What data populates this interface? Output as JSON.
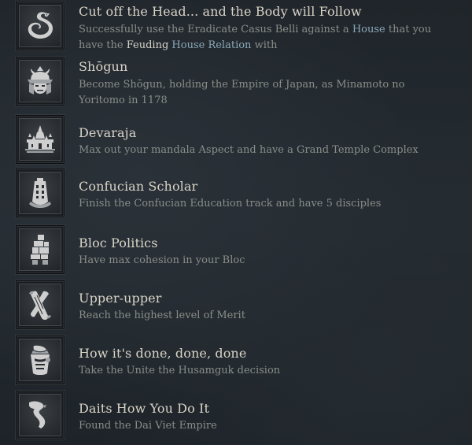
{
  "achievements": [
    {
      "title": "Cut off the Head... and the Body will Follow",
      "description": {
        "part1": "Successfully use the Eradicate Casus Belli against a ",
        "link1": "House",
        "part2": " that you have the ",
        "bold1": "Feuding",
        "part3": " ",
        "link2": "House Relation",
        "part4": " with"
      },
      "icon": "serpent-icon"
    },
    {
      "title": "Shōgun",
      "description": "Become Shōgun, holding the Empire of Japan, as Minamoto no Yoritomo in 1178",
      "icon": "samurai-helmet-icon"
    },
    {
      "title": "Devaraja",
      "description": "Max out your mandala Aspect and have a Grand Temple Complex",
      "icon": "temple-icon"
    },
    {
      "title": "Confucian Scholar",
      "description": "Finish the Confucian Education track and have 5 disciples",
      "icon": "bell-icon"
    },
    {
      "title": "Bloc Politics",
      "description": "Have max cohesion in your Bloc",
      "icon": "stacked-blocks-icon"
    },
    {
      "title": "Upper-upper",
      "description": "Reach the highest level of Merit",
      "icon": "scroll-icon"
    },
    {
      "title": "How it's done, done, done",
      "description": "Take the Unite the Husamguk decision",
      "icon": "noodle-cup-icon"
    },
    {
      "title": "Daits How You Do It",
      "description": "Found the Dai Viet Empire",
      "icon": "vietnam-map-icon"
    }
  ]
}
